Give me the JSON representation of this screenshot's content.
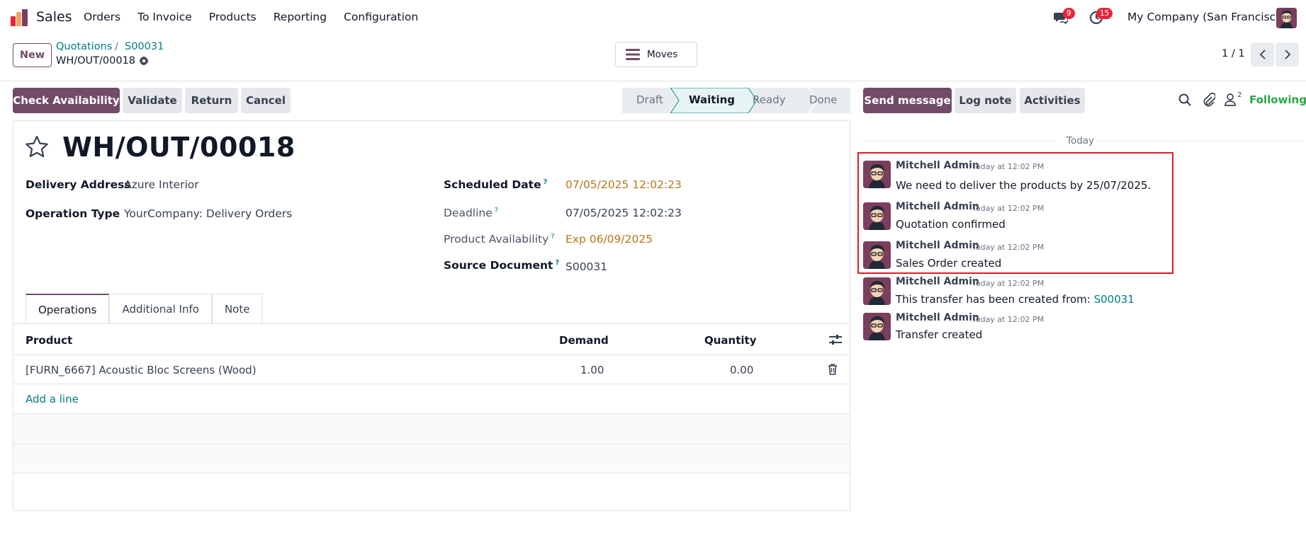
{
  "nav": {
    "app_name": "Sales",
    "menu": [
      "Orders",
      "To Invoice",
      "Products",
      "Reporting",
      "Configuration"
    ],
    "messages_count": "9",
    "activities_count": "15",
    "company": "My Company (San Francisco)"
  },
  "control_panel": {
    "new_label": "New",
    "breadcrumb_parent": "Quotations",
    "breadcrumb_sep": "/",
    "breadcrumb_order": "S00031",
    "record_name": "WH/OUT/00018",
    "moves_label": "Moves",
    "pager": "1 / 1"
  },
  "actions": {
    "check_availability": "Check Availability",
    "validate": "Validate",
    "return": "Return",
    "cancel": "Cancel"
  },
  "statusbar": {
    "stages": [
      "Draft",
      "Waiting",
      "Ready",
      "Done"
    ],
    "current": "Waiting"
  },
  "form": {
    "title": "WH/OUT/00018",
    "delivery_address_label": "Delivery Address",
    "delivery_address": "Azure Interior",
    "operation_type_label": "Operation Type",
    "operation_type": "YourCompany: Delivery Orders",
    "scheduled_date_label": "Scheduled Date",
    "scheduled_date": "07/05/2025 12:02:23",
    "deadline_label": "Deadline",
    "deadline": "07/05/2025 12:02:23",
    "product_availability_label": "Product Availability",
    "product_availability": "Exp 06/09/2025",
    "source_document_label": "Source Document",
    "source_document": "S00031",
    "help_mark": "?"
  },
  "tabs": [
    "Operations",
    "Additional Info",
    "Note"
  ],
  "table": {
    "headers": {
      "product": "Product",
      "demand": "Demand",
      "quantity": "Quantity"
    },
    "rows": [
      {
        "product": "[FURN_6667] Acoustic Bloc Screens (Wood)",
        "demand": "1.00",
        "quantity": "0.00"
      }
    ],
    "add_line": "Add a line"
  },
  "chatter": {
    "send_message": "Send message",
    "log_note": "Log note",
    "activities": "Activities",
    "followers_count": "2",
    "following": "Following",
    "date_separator": "Today",
    "messages": [
      {
        "author": "Mitchell Admin",
        "time": "Today at 12:02 PM",
        "body": " We need to deliver the products by 25/07/2025."
      },
      {
        "author": "Mitchell Admin",
        "time": "Today at 12:02 PM",
        "body": "Quotation confirmed"
      },
      {
        "author": "Mitchell Admin",
        "time": "Today at 12:02 PM",
        "body": "Sales Order created"
      },
      {
        "author": "Mitchell Admin",
        "time": "Today at 12:02 PM",
        "body": "This transfer has been created from: ",
        "link": "S00031"
      },
      {
        "author": "Mitchell Admin",
        "time": "Today at 12:02 PM",
        "body": "Transfer created"
      }
    ]
  },
  "colors": {
    "brand": "#714B67",
    "link": "#017e84",
    "warning": "#b7761a",
    "highlight": "#e01b24"
  }
}
